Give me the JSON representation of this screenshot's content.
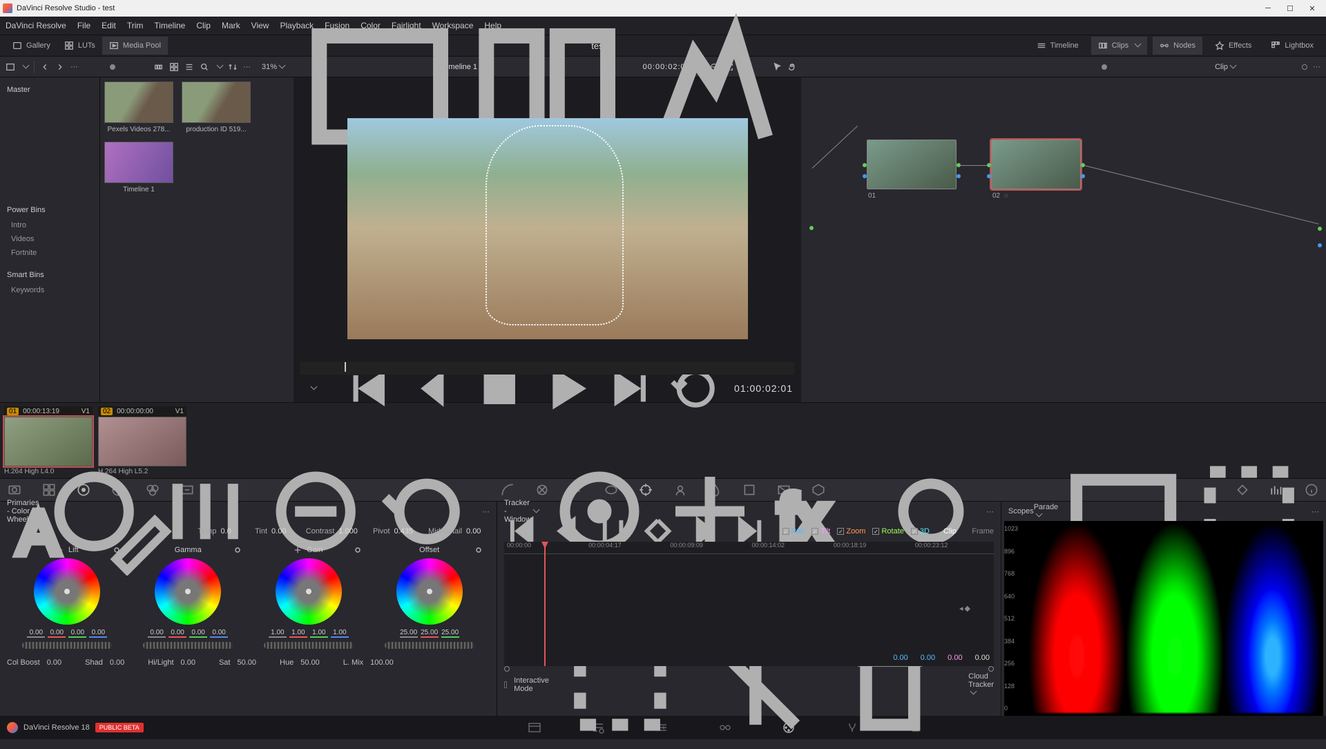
{
  "app": {
    "title": "DaVinci Resolve Studio - test"
  },
  "menus": [
    "DaVinci Resolve",
    "File",
    "Edit",
    "Trim",
    "Timeline",
    "Clip",
    "Mark",
    "View",
    "Playback",
    "Fusion",
    "Color",
    "Fairlight",
    "Workspace",
    "Help"
  ],
  "tabbar": {
    "gallery": "Gallery",
    "luts": "LUTs",
    "mediapool": "Media Pool",
    "project": "test",
    "timeline": "Timeline",
    "clips": "Clips",
    "nodes": "Nodes",
    "effects": "Effects",
    "lightbox": "Lightbox"
  },
  "toolstrip": {
    "zoom": "31%",
    "timeline_name": "Timeline 1",
    "timecode": "00:00:02:01",
    "nodemode": "Clip"
  },
  "mediapool": {
    "master": "Master",
    "clips": [
      {
        "label": "Pexels Videos 278...",
        "variant": "a"
      },
      {
        "label": "production ID 519...",
        "variant": "b"
      },
      {
        "label": "Timeline 1",
        "variant": "tl"
      }
    ],
    "powerbins": "Power Bins",
    "binitems": [
      "Intro",
      "Videos",
      "Fortnite"
    ],
    "smartbins": "Smart Bins",
    "smartitems": [
      "Keywords"
    ]
  },
  "viewer": {
    "master_tc": "01:00:02:01"
  },
  "nodes": {
    "n1": "01",
    "n2": "02"
  },
  "clipstrip": [
    {
      "num": "01",
      "tc": "00:00:13:19",
      "trk": "V1",
      "codec": "H.264 High L4.0",
      "sel": true
    },
    {
      "num": "02",
      "tc": "00:00:00:00",
      "trk": "V1",
      "codec": "H.264 High L5.2",
      "sel": false
    }
  ],
  "wheels": {
    "title": "Primaries - Color Wheels",
    "row1": [
      {
        "l": "Temp",
        "v": "0.0"
      },
      {
        "l": "Tint",
        "v": "0.00"
      },
      {
        "l": "Contrast",
        "v": "1.000"
      },
      {
        "l": "Pivot",
        "v": "0.435"
      },
      {
        "l": "Mid/Detail",
        "v": "0.00"
      }
    ],
    "cols": [
      {
        "name": "Lift",
        "vals": [
          "0.00",
          "0.00",
          "0.00",
          "0.00"
        ]
      },
      {
        "name": "Gamma",
        "vals": [
          "0.00",
          "0.00",
          "0.00",
          "0.00"
        ]
      },
      {
        "name": "Gain",
        "vals": [
          "1.00",
          "1.00",
          "1.00",
          "1.00"
        ]
      },
      {
        "name": "Offset",
        "vals": [
          "25.00",
          "25.00",
          "25.00"
        ]
      }
    ],
    "row2": [
      {
        "l": "Col Boost",
        "v": "0.00"
      },
      {
        "l": "Shad",
        "v": "0.00"
      },
      {
        "l": "Hi/Light",
        "v": "0.00"
      },
      {
        "l": "Sat",
        "v": "50.00"
      },
      {
        "l": "Hue",
        "v": "50.00"
      },
      {
        "l": "L. Mix",
        "v": "100.00"
      }
    ]
  },
  "tracker": {
    "title": "Tracker - Window",
    "opts": [
      {
        "l": "Pan",
        "on": true
      },
      {
        "l": "Tilt",
        "on": true
      },
      {
        "l": "Zoom",
        "on": true
      },
      {
        "l": "Rotate",
        "on": true
      },
      {
        "l": "3D",
        "on": true
      }
    ],
    "modes": {
      "clip": "Clip",
      "frame": "Frame"
    },
    "ticks": [
      "00:00:00",
      "00:00:04:17",
      "00:00:09:09",
      "00:00:14:02",
      "00:00:18:19",
      "00:00:23:12"
    ],
    "vals": [
      "0.00",
      "0.00",
      "0.00",
      "0.00"
    ],
    "interactive": "Interactive Mode",
    "type": "Cloud Tracker"
  },
  "scopes": {
    "title": "Scopes",
    "mode": "Parade",
    "scale": [
      "1023",
      "896",
      "768",
      "640",
      "512",
      "384",
      "256",
      "128",
      "0"
    ]
  },
  "footer": {
    "appname": "DaVinci Resolve 18",
    "beta": "PUBLIC BETA"
  }
}
